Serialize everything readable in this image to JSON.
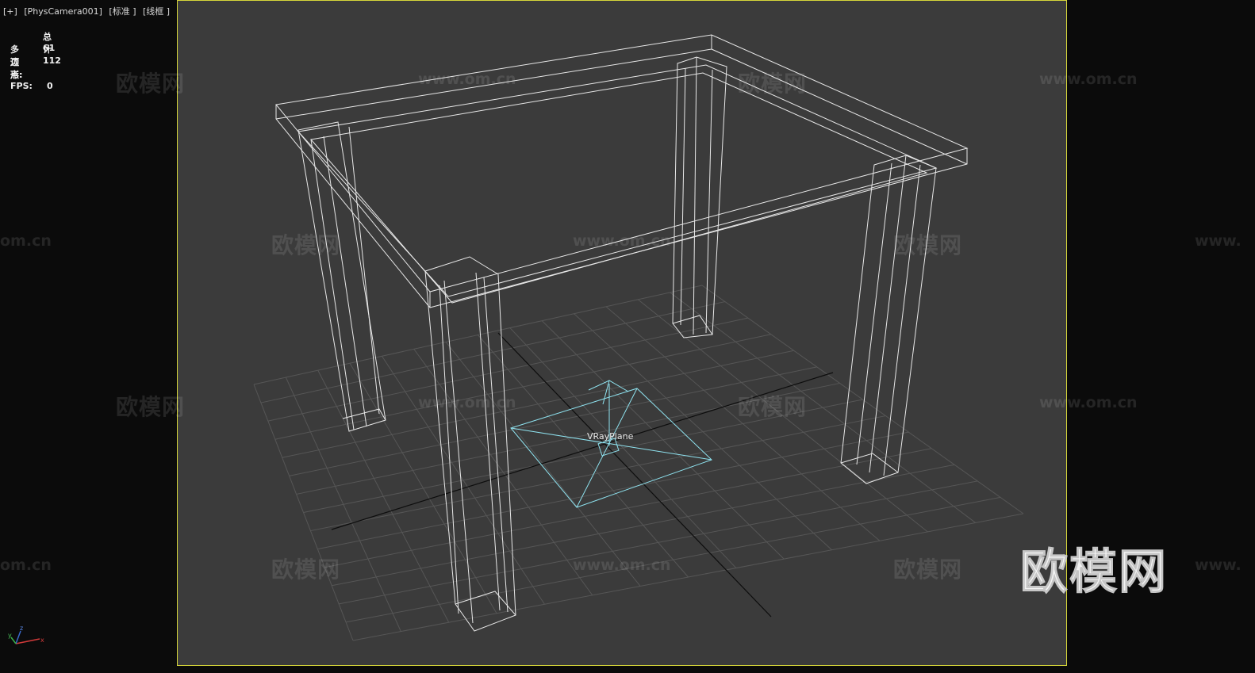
{
  "viewport": {
    "label_menu": "[+]",
    "label_camera": "[PhysCamera001]",
    "label_shading": "[标准 ]",
    "label_style": "[线框 ]"
  },
  "stats": {
    "header": "总计",
    "polygons_label": "多边形:",
    "polygons_value": "61",
    "vertices_label": "顶点:",
    "vertices_value": "112",
    "fps_label": "FPS:",
    "fps_value": "0"
  },
  "scene": {
    "object_label": "VRayPlane",
    "wireframe_color": "#e8e8e8",
    "selected_color": "#8fe3f0",
    "grid_color": "#565656",
    "axis_color": "#0d0d0d",
    "safe_frame_color": "#d6d63a"
  },
  "axis_gizmo": {
    "x": "x",
    "y": "y",
    "z": "z"
  },
  "watermarks": {
    "cn": "欧模网",
    "url": "www.om.cn",
    "url_cut_left": "om.cn",
    "url_cut_right": "www."
  },
  "brand_logo": "欧模网"
}
